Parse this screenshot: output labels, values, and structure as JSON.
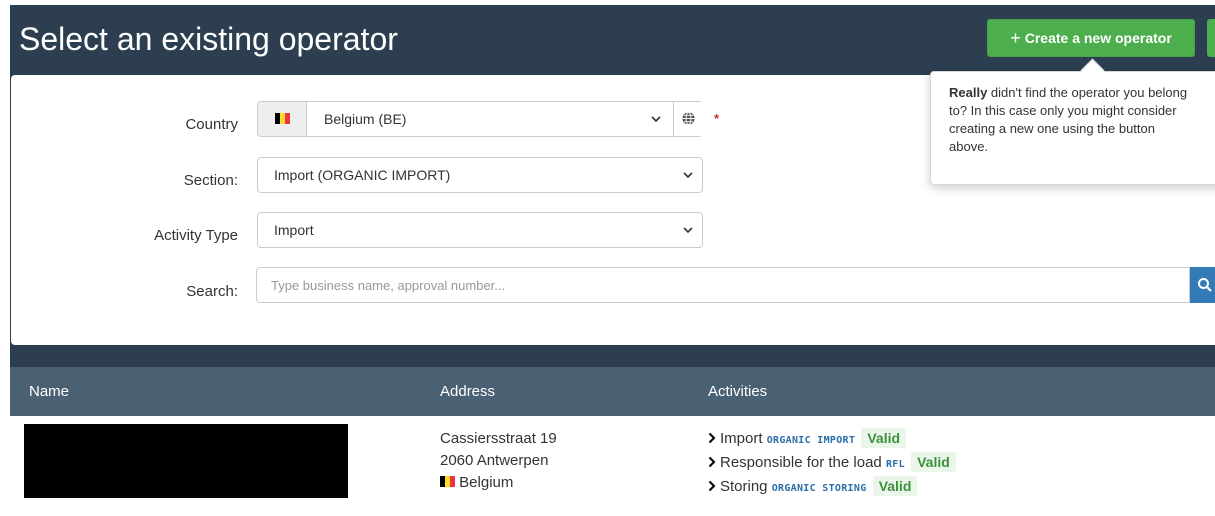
{
  "header": {
    "title": "Select an existing operator",
    "create_button": "Create a new operator"
  },
  "popover": {
    "bold": "Really",
    "line1": " didn't find the operator you belong",
    "line2": "to? In this case only you might consider",
    "line3": "creating a new one using the button",
    "line4": "above."
  },
  "form": {
    "country_label": "Country",
    "country_value": "Belgium (BE)",
    "required_mark": "*",
    "section_label": "Section:",
    "section_value": "Import (ORGANIC IMPORT)",
    "activity_label": "Activity Type",
    "activity_value": "Import",
    "search_label": "Search:",
    "search_placeholder": "Type business name, approval number..."
  },
  "table": {
    "columns": [
      "Name",
      "Address",
      "Activities"
    ],
    "rows": [
      {
        "address": {
          "street": "Cassiersstraat 19",
          "city": "2060 Antwerpen",
          "country": "Belgium"
        },
        "activities": [
          {
            "name": "Import",
            "code": "ORGANIC IMPORT",
            "status": "Valid"
          },
          {
            "name": "Responsible for the load",
            "code": "RFL",
            "status": "Valid"
          },
          {
            "name": "Storing",
            "code": "ORGANIC STORING",
            "status": "Valid"
          }
        ]
      }
    ]
  },
  "colors": {
    "header_bg": "#2c3e50",
    "table_header_bg": "#4a6073",
    "success": "#4cae4c",
    "primary": "#337ab7",
    "code": "#2a6ea8"
  },
  "icons": {
    "flag": "belgium-flag",
    "globe": "globe-icon",
    "search": "search-icon",
    "chevron": "chevron-down-icon",
    "caret": "chevron-right-icon"
  }
}
